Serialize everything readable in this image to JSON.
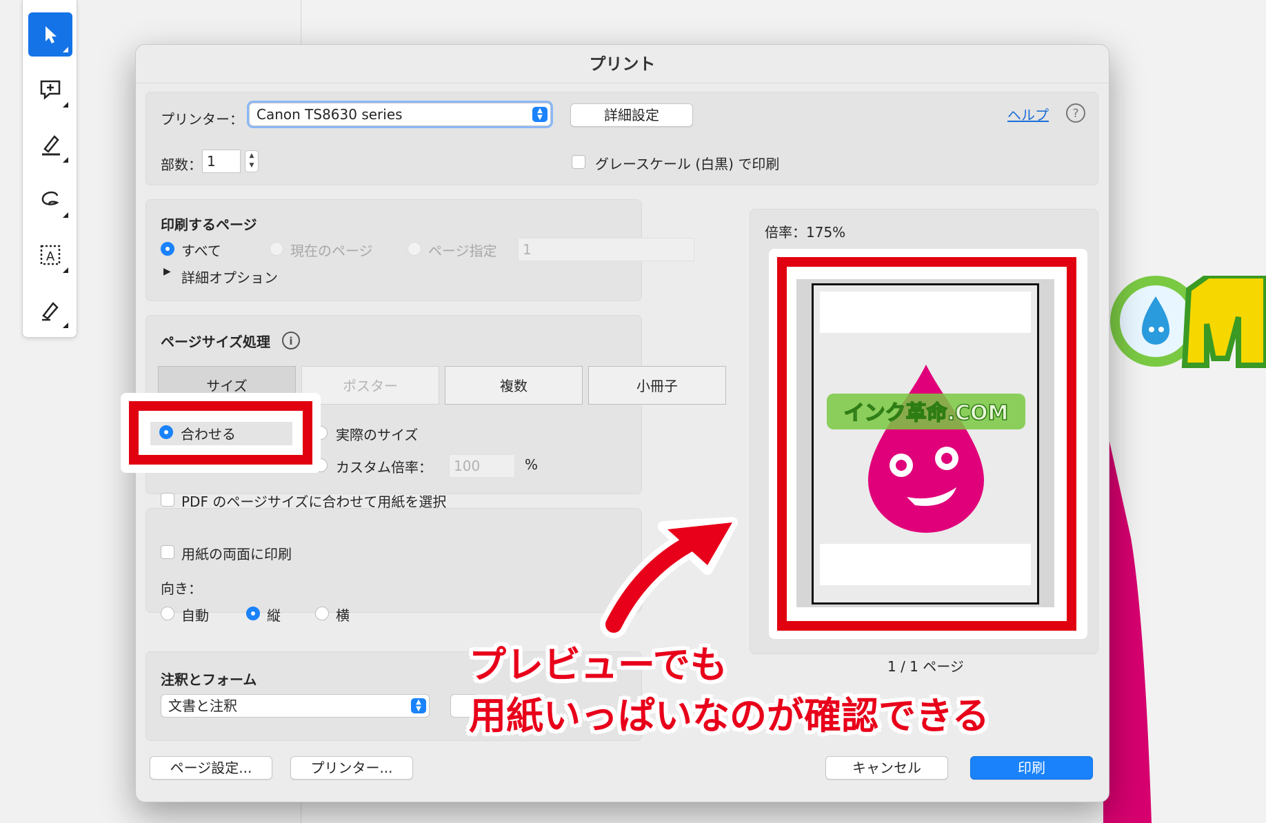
{
  "dialog": {
    "title": "プリント",
    "printer_label": "プリンター：",
    "printer_value": "Canon TS8630 series",
    "advanced_button": "詳細設定",
    "help_link": "ヘルプ",
    "help_icon": "question-circle-icon",
    "copies_label": "部数：",
    "copies_value": "1",
    "grayscale_label": "グレースケール (白黒) で印刷",
    "pages_section": {
      "title": "印刷するページ",
      "all": "すべて",
      "current": "現在のページ",
      "range": "ページ指定",
      "range_value": "1",
      "more_options": "詳細オプション",
      "selected": "all"
    },
    "page_size_section": {
      "title": "ページサイズ処理",
      "tabs": [
        "サイズ",
        "ポスター",
        "複数",
        "小冊子"
      ],
      "selected_tab": "サイズ",
      "fit": "合わせる",
      "actual": "実際のサイズ",
      "custom": "カスタム倍率：",
      "custom_value": "100",
      "percent": "%",
      "choose_paper": "PDF のページサイズに合わせて用紙を選択",
      "selected": "fit"
    },
    "duplex_label": "用紙の両面に印刷",
    "orientation": {
      "label": "向き：",
      "auto": "自動",
      "portrait": "縦",
      "landscape": "横",
      "selected": "portrait"
    },
    "comments_section": {
      "title": "注釈とフォーム",
      "value": "文書と注釈"
    },
    "preview": {
      "scale": "倍率：175%",
      "page_count": "1 / 1 ページ",
      "logo_text": "インク革命.COM"
    },
    "page_setup_button": "ページ設定...",
    "printer_button": "プリンター...",
    "cancel_button": "キャンセル",
    "print_button": "印刷"
  },
  "annotation": {
    "line1": "プレビューでも",
    "line2": "用紙いっぱいなのが確認できる",
    "color": "#e8001a"
  },
  "colors": {
    "accent": "#1a82fb",
    "highlight_red": "#e00010",
    "mascot_pink": "#e0007a"
  }
}
